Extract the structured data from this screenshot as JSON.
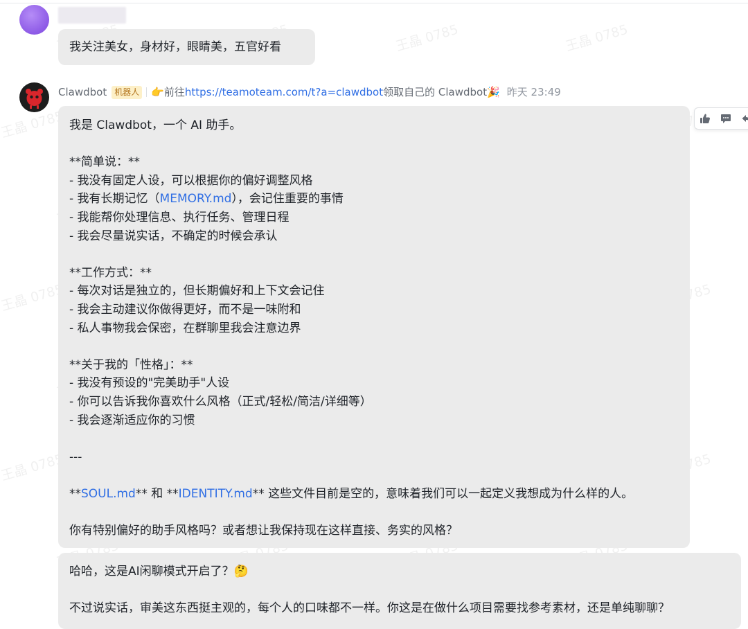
{
  "user_message": {
    "text": "我关注美女，身材好，眼睛美，五官好看"
  },
  "bot": {
    "name": "Clawdbot",
    "tag": "机器人",
    "promo_prefix": "👉前往 ",
    "promo_link": "https://teamoteam.com/t?a=clawdbot",
    "promo_suffix": " 领取自己的 Clawdbot🎉",
    "time": "昨天 23:49"
  },
  "bot_message": {
    "intro": "我是 Clawdbot，一个 AI 助手。",
    "section1_title": "**简单说：**",
    "s1_l1": "- 我没有固定人设，可以根据你的偏好调整风格",
    "s1_l2_pre": "- 我有长期记忆（",
    "s1_l2_link": "MEMORY.md",
    "s1_l2_post": "），会记住重要的事情",
    "s1_l3": "- 我能帮你处理信息、执行任务、管理日程",
    "s1_l4": "- 我会尽量说实话，不确定的时候会承认",
    "section2_title": "**工作方式：**",
    "s2_l1": "- 每次对话是独立的，但长期偏好和上下文会记住",
    "s2_l2": "- 我会主动建议你做得更好，而不是一味附和",
    "s2_l3": "- 私人事物我会保密，在群聊里我会注意边界",
    "section3_title": "**关于我的「性格」：**",
    "s3_l1": "- 我没有预设的\"完美助手\"人设",
    "s3_l2": "- 你可以告诉我你喜欢什么风格（正式/轻松/简洁/详细等）",
    "s3_l3": "- 我会逐渐适应你的习惯",
    "divider": "---",
    "files_pre": "**",
    "files_link1": "SOUL.md",
    "files_mid": "** 和 **",
    "files_link2": "IDENTITY.md",
    "files_post": "** 这些文件目前是空的，意味着我们可以一起定义我想成为什么样的人。",
    "question": "你有特别偏好的助手风格吗？或者想让我保持现在这样直接、务实的风格？"
  },
  "bot_reply": {
    "line1": "哈哈，这是AI闲聊模式开启了？🤔",
    "line2": "不过说实话，审美这东西挺主观的，每个人的口味都不一样。你这是在做什么项目需要找参考素材，还是单纯聊聊？"
  },
  "watermark": "王晶 0785",
  "colors": {
    "link": "#2f6ee4",
    "bubble": "#ebebeb",
    "tag_bg": "#fdf0c8",
    "tag_text": "#b3741c"
  },
  "icons": [
    "thumbs-up-icon",
    "comment-icon",
    "reply-icon"
  ]
}
